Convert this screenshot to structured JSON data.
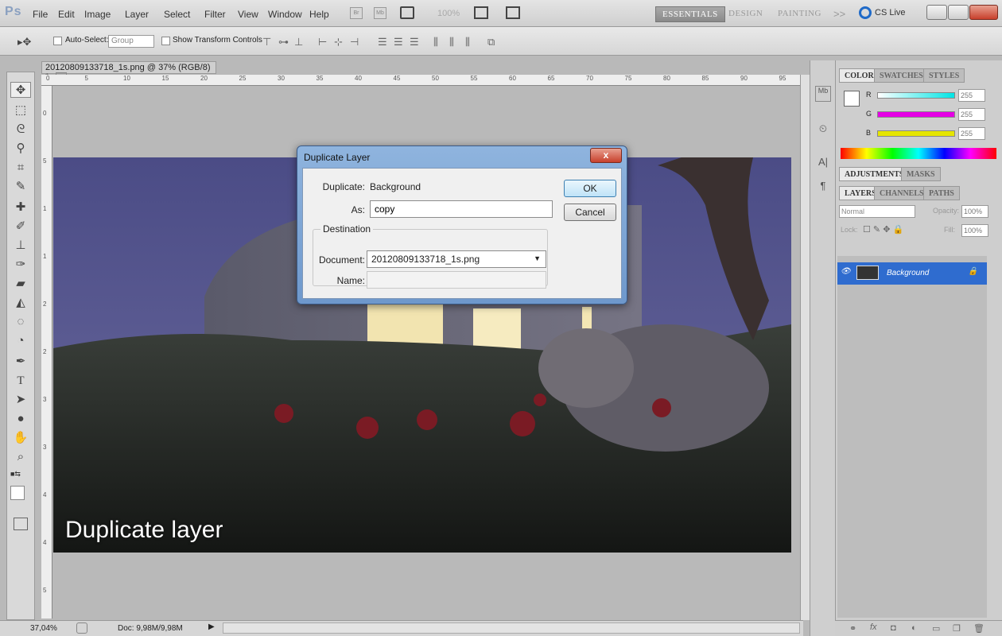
{
  "menubar": {
    "app_logo": "Ps",
    "items": [
      "File",
      "Edit",
      "Image",
      "Layer",
      "Select",
      "Filter",
      "View",
      "Window",
      "Help"
    ],
    "br_label": "Br",
    "mb_label": "Mb",
    "zoom_value": "100%",
    "workspaces": [
      "ESSENTIALS",
      "DESIGN",
      "PAINTING"
    ],
    "more": ">>",
    "cslive": "CS Live"
  },
  "options": {
    "auto_select_label": "Auto-Select:",
    "auto_select_value": "Group",
    "transform_label": "Show Transform Controls"
  },
  "document": {
    "tab_title": "20120809133718_1s.png @ 37% (RGB/8) *",
    "caption": "Duplicate layer",
    "ruler_top_ticks": [
      "0",
      "5",
      "10",
      "15",
      "20",
      "25",
      "30",
      "35",
      "40",
      "45",
      "50",
      "55",
      "60",
      "65",
      "70",
      "75",
      "80",
      "85",
      "90",
      "95"
    ],
    "ruler_left_ticks": [
      "0",
      "5",
      "1",
      "1",
      "2",
      "2",
      "3",
      "3",
      "4",
      "4",
      "5"
    ]
  },
  "status": {
    "zoom": "37,04%",
    "doc_size": "Doc: 9,98M/9,98M"
  },
  "panels": {
    "color_tabs": [
      "COLOR",
      "SWATCHES",
      "STYLES"
    ],
    "channels": [
      {
        "label": "R",
        "value": "255",
        "gradient": "#00e5e5"
      },
      {
        "label": "G",
        "value": "255",
        "gradient": "#e500e5"
      },
      {
        "label": "B",
        "value": "255",
        "gradient": "#e5e500"
      }
    ],
    "adj_tabs": [
      "ADJUSTMENTS",
      "MASKS"
    ],
    "layer_tabs": [
      "LAYERS",
      "CHANNELS",
      "PATHS"
    ],
    "blend_mode": "Normal",
    "opacity_label": "Opacity:",
    "opacity_value": "100%",
    "lock_label": "Lock:",
    "fill_label": "Fill:",
    "fill_value": "100%",
    "layer_name": "Background"
  },
  "dialog": {
    "title": "Duplicate Layer",
    "duplicate_label": "Duplicate:",
    "duplicate_value": "Background",
    "as_label": "As:",
    "as_value": "copy",
    "destination_label": "Destination",
    "document_label": "Document:",
    "document_value": "20120809133718_1s.png",
    "name_label": "Name:",
    "name_value": "",
    "ok_label": "OK",
    "cancel_label": "Cancel",
    "close_glyph": "x"
  },
  "colors": {
    "accent_blue": "#2f6ccf",
    "sky": "#5e5f94",
    "window_glow": "#f4e6b0"
  }
}
